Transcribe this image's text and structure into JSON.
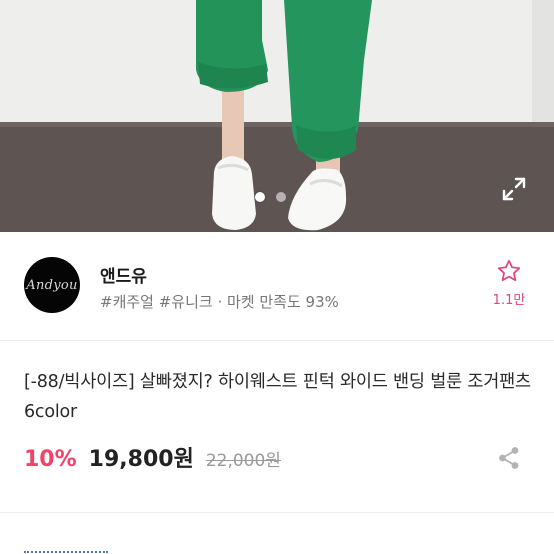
{
  "gallery": {
    "page_count": 2,
    "active_page": 1,
    "expand_icon": "expand-icon"
  },
  "shop": {
    "name": "앤드유",
    "avatar_text": "Andyou",
    "meta": "#캐주얼 #유니크 · 마켓 만족도 93%",
    "favorite_count": "1.1만",
    "favorite_icon": "star-outline-icon"
  },
  "product": {
    "title": "[-88/빅사이즈] 살빠졌지? 하이웨스트 핀턱 와이드 밴딩 벌룬 조거팬츠 6color",
    "discount": "10%",
    "price": "19,800원",
    "original_price": "22,000원",
    "share_icon": "share-icon"
  },
  "colors": {
    "accent_pink": "#f0426a",
    "pants_green": "#23935a",
    "floor": "#5e5553"
  }
}
